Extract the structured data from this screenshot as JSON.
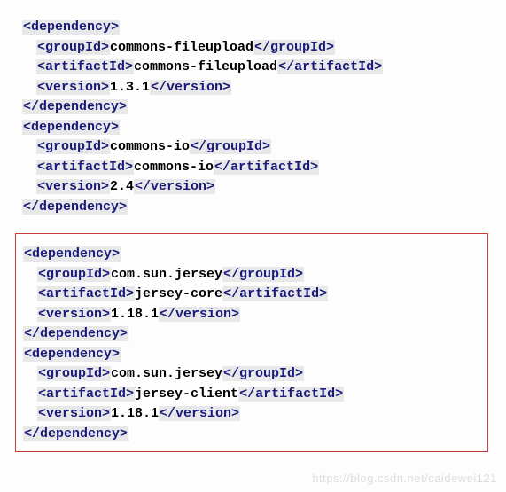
{
  "tags": {
    "depOpen": "<dependency>",
    "depClose": "</dependency>",
    "groupOpen": "<groupId>",
    "groupClose": "</groupId>",
    "artOpen": "<artifactId>",
    "artClose": "</artifactId>",
    "verOpen": "<version>",
    "verClose": "</version>"
  },
  "deps": [
    {
      "groupId": "commons-fileupload",
      "artifactId": "commons-fileupload",
      "version": "1.3.1"
    },
    {
      "groupId": "commons-io",
      "artifactId": "commons-io",
      "version": "2.4"
    },
    {
      "groupId": "com.sun.jersey",
      "artifactId": "jersey-core",
      "version": "1.18.1"
    },
    {
      "groupId": "com.sun.jersey",
      "artifactId": "jersey-client",
      "version": "1.18.1"
    }
  ],
  "watermark": "https://blog.csdn.net/caidewei121"
}
